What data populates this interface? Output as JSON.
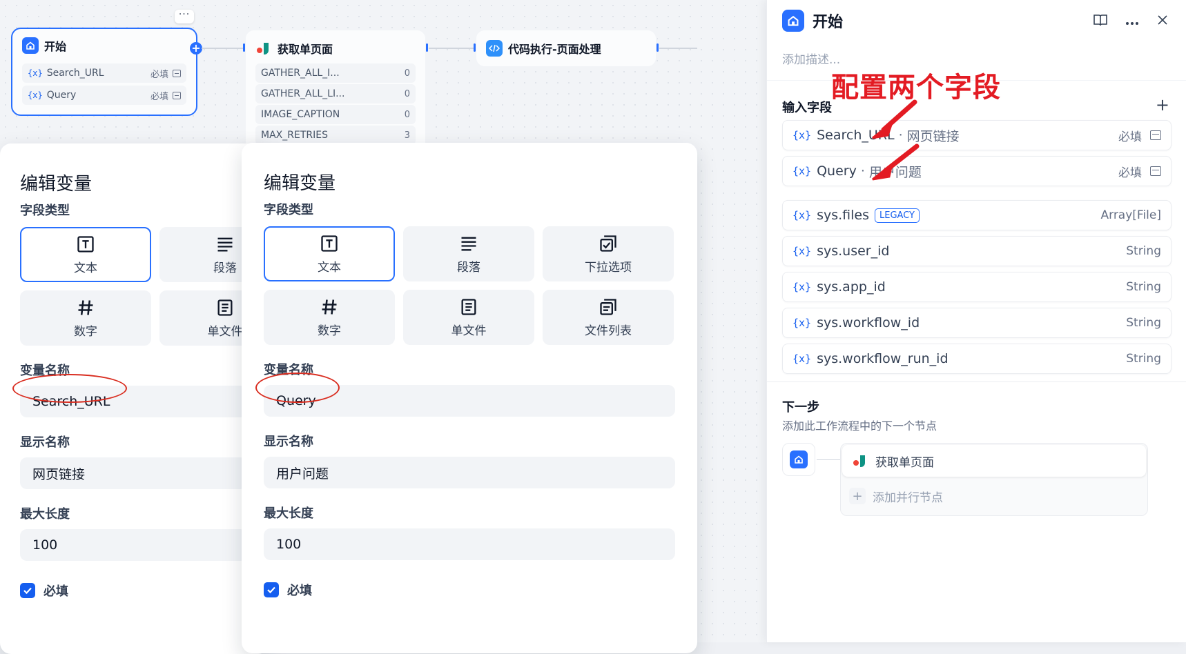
{
  "canvas": {
    "start_node": {
      "title": "开始",
      "vars": [
        {
          "name": "Search_URL",
          "required": "必填"
        },
        {
          "name": "Query",
          "required": "必填"
        }
      ]
    },
    "fetch_node": {
      "title": "获取单页面",
      "rows": [
        {
          "name": "GATHER_ALL_I...",
          "value": "0"
        },
        {
          "name": "GATHER_ALL_LI...",
          "value": "0"
        },
        {
          "name": "IMAGE_CAPTION",
          "value": "0"
        },
        {
          "name": "MAX_RETRIES",
          "value": "3"
        }
      ]
    },
    "code_node": {
      "title": "代码执行-页面处理"
    },
    "var_prefix": "{x}",
    "more_dots": "···"
  },
  "modal_left": {
    "title": "编辑变量",
    "field_type_label": "字段类型",
    "types": [
      "文本",
      "段落",
      "数字",
      "单文件"
    ],
    "var_name_label": "变量名称",
    "var_name_value": "Search_URL",
    "display_name_label": "显示名称",
    "display_name_value": "网页链接",
    "max_length_label": "最大长度",
    "max_length_value": "100",
    "required_label": "必填"
  },
  "modal_right": {
    "title": "编辑变量",
    "field_type_label": "字段类型",
    "types": [
      "文本",
      "段落",
      "下拉选项",
      "数字",
      "单文件",
      "文件列表"
    ],
    "var_name_label": "变量名称",
    "var_name_value": "Query",
    "display_name_label": "显示名称",
    "display_name_value": "用户问题",
    "max_length_label": "最大长度",
    "max_length_value": "100",
    "required_label": "必填"
  },
  "panel": {
    "title": "开始",
    "description_placeholder": "添加描述...",
    "input_fields_label": "输入字段",
    "annotation": "配置两个字段",
    "inputs": [
      {
        "name": "Search_URL",
        "display": "网页链接",
        "required": "必填"
      },
      {
        "name": "Query",
        "display": "用户问题",
        "required": "必填"
      }
    ],
    "sys_vars": [
      {
        "name": "sys.files",
        "badge": "LEGACY",
        "type": "Array[File]"
      },
      {
        "name": "sys.user_id",
        "type": "String"
      },
      {
        "name": "sys.app_id",
        "type": "String"
      },
      {
        "name": "sys.workflow_id",
        "type": "String"
      },
      {
        "name": "sys.workflow_run_id",
        "type": "String"
      }
    ],
    "next_step_label": "下一步",
    "next_step_desc": "添加此工作流程中的下一个节点",
    "next_node": "获取单页面",
    "add_parallel": "添加并行节点",
    "separator": "·"
  },
  "colors": {
    "accent": "#2970ff",
    "annotation_red": "#e31b23"
  }
}
